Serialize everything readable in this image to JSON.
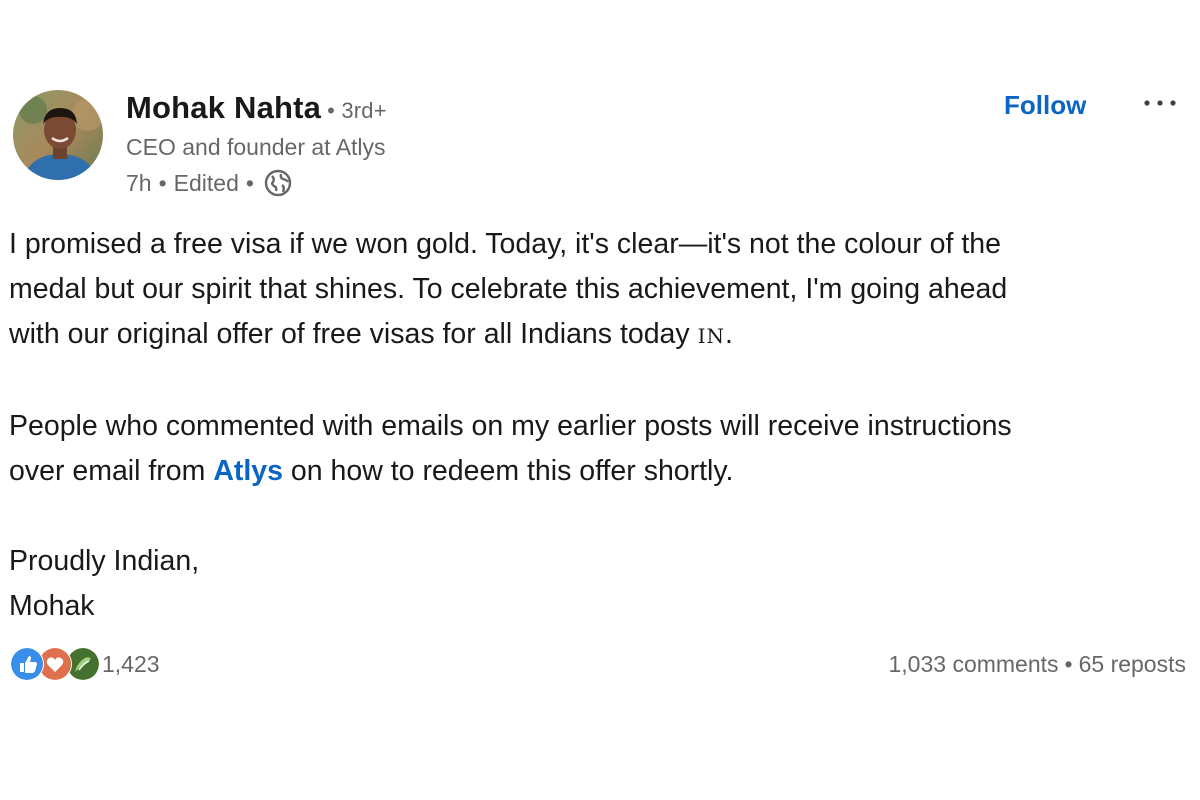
{
  "author": {
    "name": "Mohak Nahta",
    "degree": "• 3rd+",
    "headline": "CEO and founder at Atlys",
    "time": "7h",
    "edited": "Edited",
    "separator": "•",
    "visibility_icon": "globe-icon"
  },
  "actions": {
    "follow_label": "Follow",
    "more_icon": "ellipsis-icon"
  },
  "post": {
    "p1": {
      "line1": "I promised a free visa if we won gold. Today, it's clear—it's not the colour of the",
      "line2": "medal but our spirit that shines. To celebrate this achievement, I'm going ahead",
      "line3": "with our original offer of free visas for all Indians today ",
      "flag": "IN",
      "line3_end": "."
    },
    "p2": {
      "line1": "People who commented with emails on my earlier posts will receive instructions",
      "line2_before": "over email from ",
      "company_link": "Atlys",
      "line2_after": " on how to redeem this offer shortly."
    },
    "p3": {
      "line1": "Proudly Indian,",
      "line2": "Mohak"
    }
  },
  "social": {
    "reaction_icons": [
      "like-icon",
      "love-icon",
      "celebrate-icon"
    ],
    "reaction_count": "1,423",
    "comments": "1,033 comments",
    "separator": "•",
    "reposts": "65 reposts"
  },
  "colors": {
    "link_blue": "#0a66c2",
    "like_blue": "#378fe9",
    "love_red": "#df704d",
    "celebrate_green": "#44712e"
  }
}
